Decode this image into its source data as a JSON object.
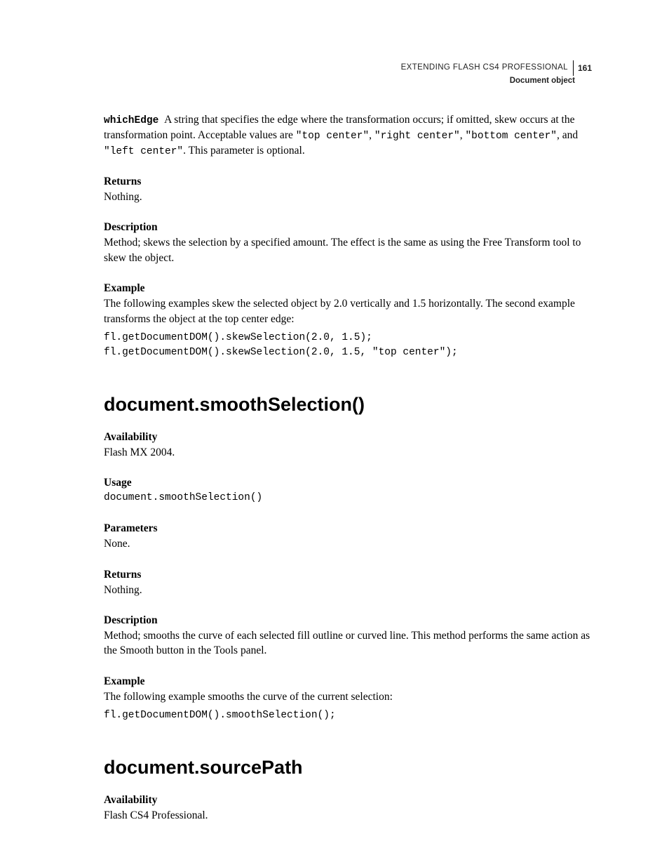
{
  "header": {
    "book_title": "EXTENDING FLASH CS4 PROFESSIONAL",
    "page_number": "161",
    "section": "Document object"
  },
  "skew": {
    "param_name": "whichEdge",
    "param_text_1": "A string that specifies the edge where the transformation occurs; if omitted, skew occurs at the transformation point. Acceptable values are ",
    "val_top": "\"top center\"",
    "sep1": ", ",
    "val_right": "\"right center\"",
    "sep2": ", ",
    "val_bottom": "\"bottom center\"",
    "sep3": ", and ",
    "val_left": "\"left center\"",
    "param_text_2": ". This parameter is optional.",
    "returns_h": "Returns",
    "returns_body": "Nothing.",
    "desc_h": "Description",
    "desc_body": "Method; skews the selection by a specified amount. The effect is the same as using the Free Transform tool to skew the object.",
    "example_h": "Example",
    "example_body": "The following examples skew the selected object by 2.0 vertically and 1.5 horizontally. The second example transforms the object at the top center edge:",
    "code": "fl.getDocumentDOM().skewSelection(2.0, 1.5);\nfl.getDocumentDOM().skewSelection(2.0, 1.5, \"top center\");"
  },
  "smooth": {
    "title": "document.smoothSelection()",
    "avail_h": "Availability",
    "avail_body": "Flash MX 2004.",
    "usage_h": "Usage",
    "usage_code": "document.smoothSelection()",
    "params_h": "Parameters",
    "params_body": "None.",
    "returns_h": "Returns",
    "returns_body": "Nothing.",
    "desc_h": "Description",
    "desc_body": "Method; smooths the curve of each selected fill outline or curved line. This method performs the same action as the Smooth button in the Tools panel.",
    "example_h": "Example",
    "example_body": "The following example smooths the curve of the current selection:",
    "code": "fl.getDocumentDOM().smoothSelection();"
  },
  "sourcepath": {
    "title": "document.sourcePath",
    "avail_h": "Availability",
    "avail_body": "Flash CS4 Professional."
  }
}
